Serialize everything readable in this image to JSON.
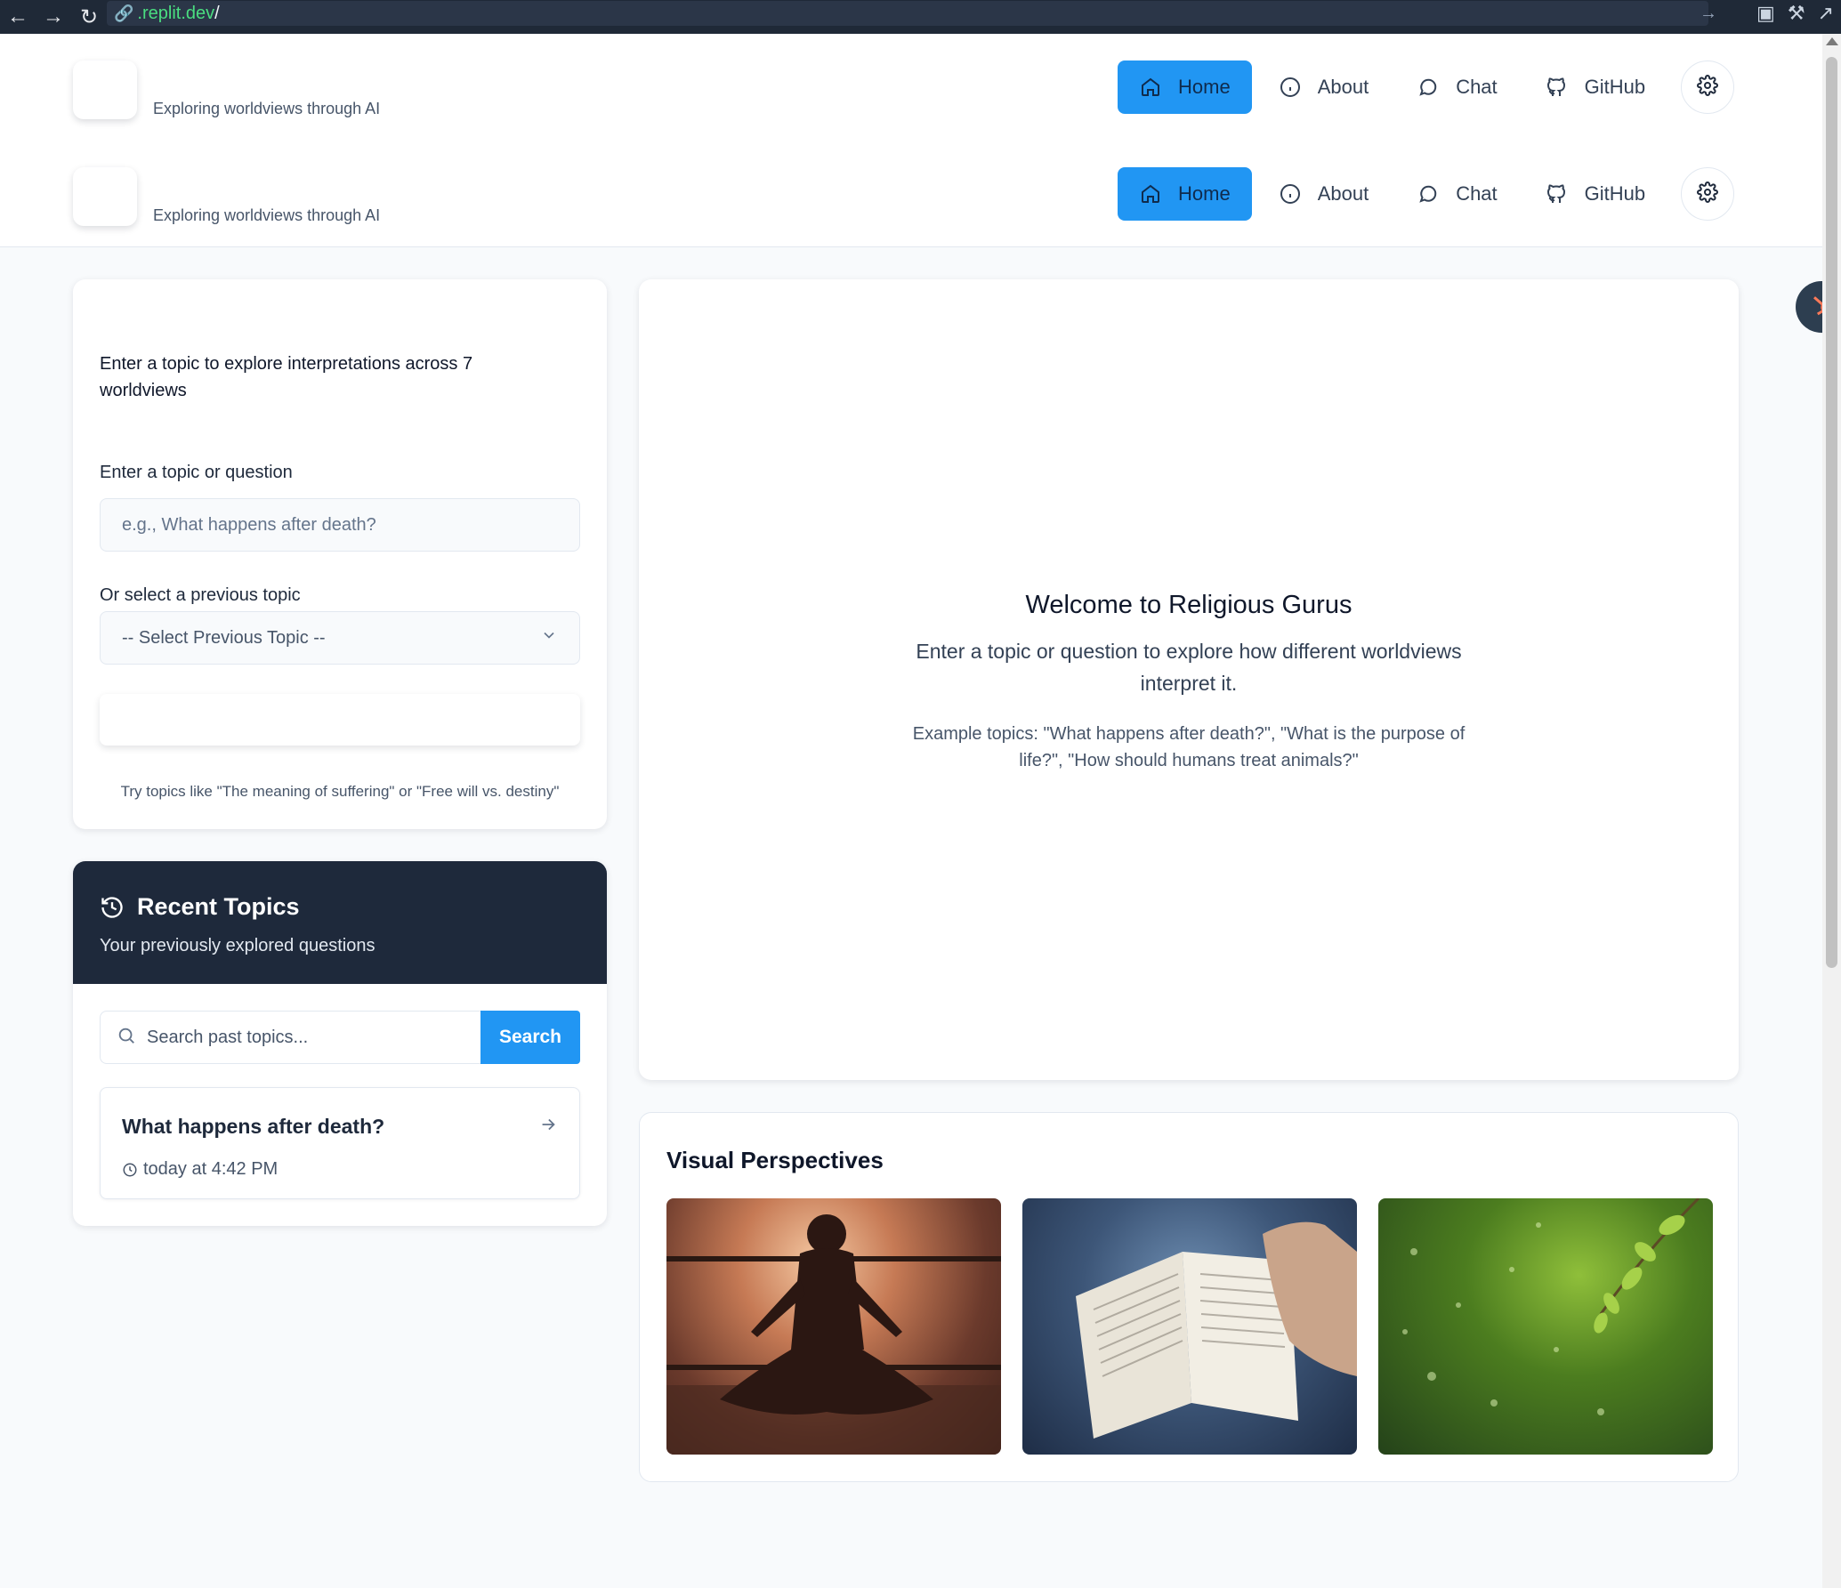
{
  "browser": {
    "url_host": ".replit.dev",
    "url_rest": "/"
  },
  "header": {
    "rows": [
      {
        "tagline": "Exploring worldviews through AI",
        "nav": [
          {
            "label": "Home",
            "icon": "home-icon",
            "active": true
          },
          {
            "label": "About",
            "icon": "info-icon",
            "active": false
          },
          {
            "label": "Chat",
            "icon": "chat-icon",
            "active": false
          },
          {
            "label": "GitHub",
            "icon": "github-icon",
            "active": false
          }
        ]
      },
      {
        "tagline": "Exploring worldviews through AI",
        "nav": [
          {
            "label": "Home",
            "icon": "home-icon",
            "active": true
          },
          {
            "label": "About",
            "icon": "info-icon",
            "active": false
          },
          {
            "label": "Chat",
            "icon": "chat-icon",
            "active": false
          },
          {
            "label": "GitHub",
            "icon": "github-icon",
            "active": false
          }
        ]
      }
    ]
  },
  "topic_form": {
    "description": "Enter a topic to explore interpretations across 7 worldviews",
    "topic_label": "Enter a topic or question",
    "topic_placeholder": "e.g., What happens after death?",
    "select_label": "Or select a previous topic",
    "select_value": "-- Select Previous Topic --",
    "hint": "Try topics like \"The meaning of suffering\" or \"Free will vs. destiny\""
  },
  "recent": {
    "title": "Recent Topics",
    "subtitle": "Your previously explored questions",
    "search_placeholder": "Search past topics...",
    "search_button": "Search",
    "items": [
      {
        "title": "What happens after death?",
        "time": "today at 4:42 PM"
      }
    ]
  },
  "welcome": {
    "title": "Welcome to Religious Gurus",
    "text": "Enter a topic or question to explore how different worldviews interpret it.",
    "examples": "Example topics: \"What happens after death?\", \"What is the purpose of life?\", \"How should humans treat animals?\""
  },
  "visual": {
    "title": "Visual Perspectives",
    "images": [
      "meditation-photo",
      "open-bible-photo",
      "green-leaves-photo"
    ]
  },
  "colors": {
    "accent": "#2196f3",
    "dark_header": "#1e293b",
    "hubspot": "#ff7a59"
  }
}
